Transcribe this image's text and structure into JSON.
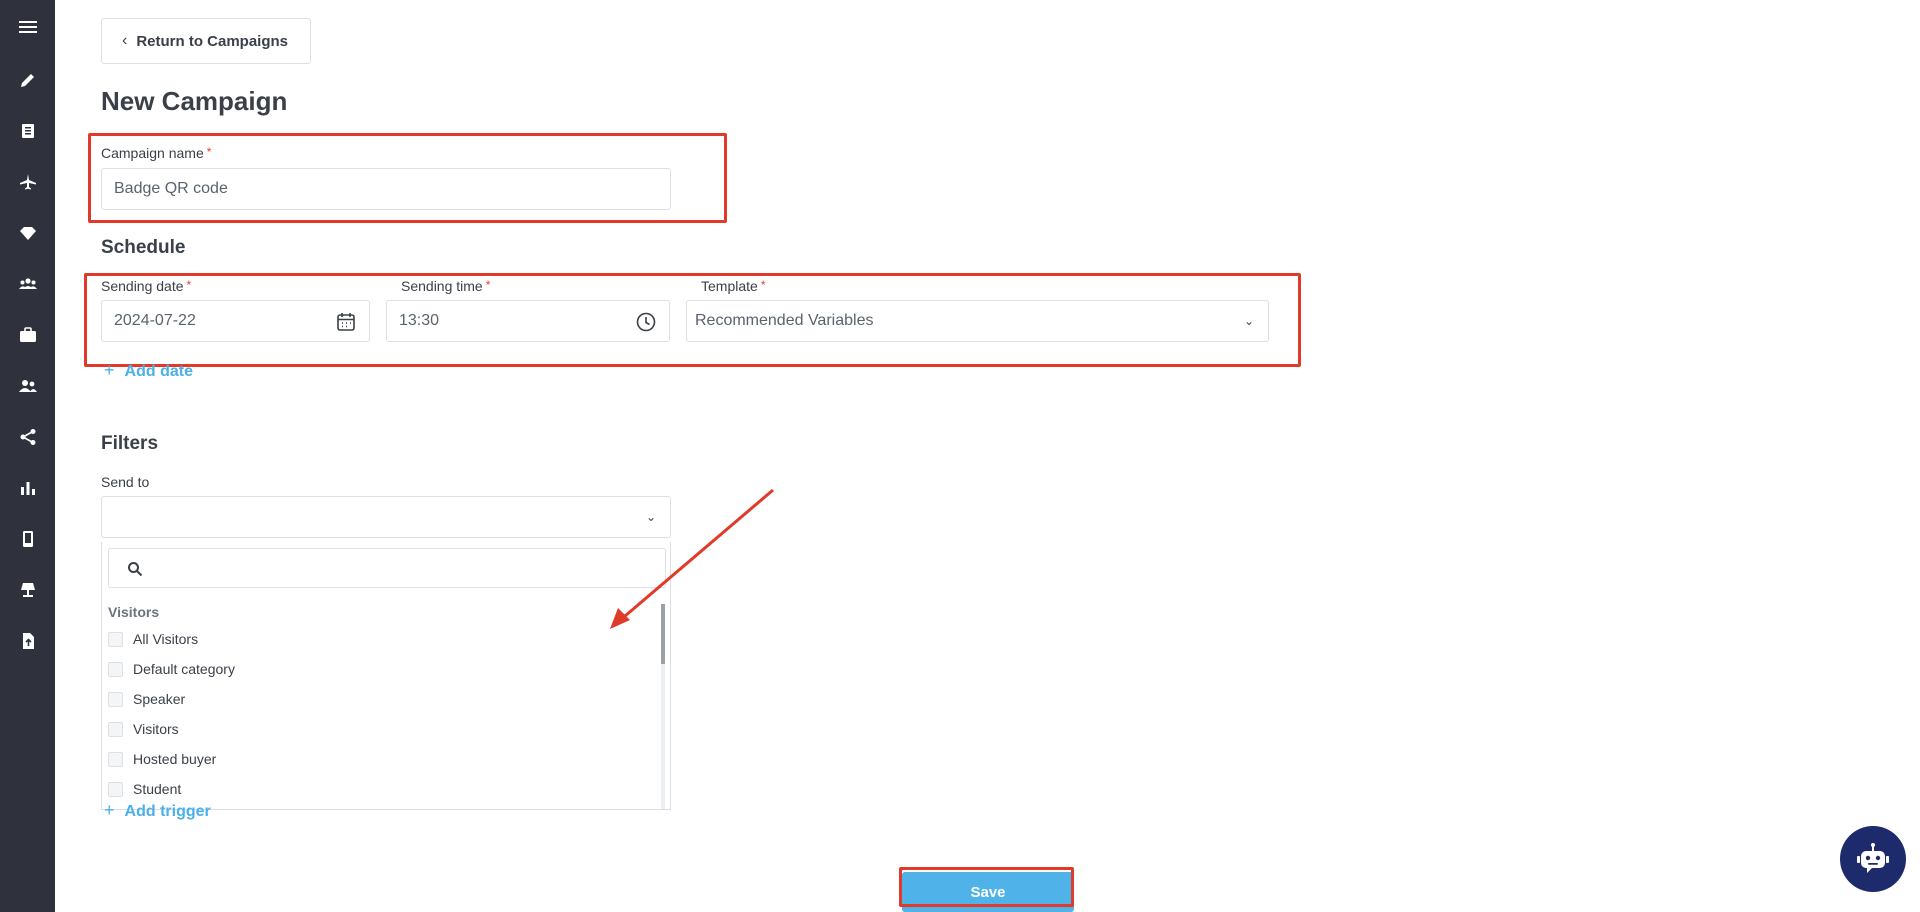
{
  "sidebar": {
    "icons": [
      "menu-icon",
      "pencil-icon",
      "document-icon",
      "airplane-icon",
      "diamond-icon",
      "group-icon",
      "briefcase-icon",
      "users-icon",
      "share-icon",
      "bar-chart-icon",
      "mobile-icon",
      "lamp-icon",
      "file-upload-icon"
    ]
  },
  "header": {
    "back_label": "Return to Campaigns",
    "title": "New Campaign"
  },
  "campaign": {
    "name_label": "Campaign name",
    "required_mark": "*",
    "name_value": "Badge QR code"
  },
  "schedule": {
    "title": "Schedule",
    "date_label": "Sending date",
    "date_value": "2024-07-22",
    "time_label": "Sending time",
    "time_value": "13:30",
    "template_label": "Template",
    "template_value": "Recommended Variables",
    "add_date_label": "Add date"
  },
  "filters": {
    "title": "Filters",
    "send_to_label": "Send to",
    "send_to_value": "",
    "search_placeholder": "",
    "group_title": "Visitors",
    "options": [
      "All Visitors",
      "Default category",
      "Speaker",
      "Visitors",
      "Hosted buyer",
      "Student"
    ],
    "add_trigger_label": "Add trigger"
  },
  "actions": {
    "save_label": "Save"
  },
  "colors": {
    "sidebar_bg": "#2f323d",
    "accent": "#4fb2e8",
    "highlight": "#e03b2a",
    "chatbot_bg": "#1d2a6b"
  }
}
